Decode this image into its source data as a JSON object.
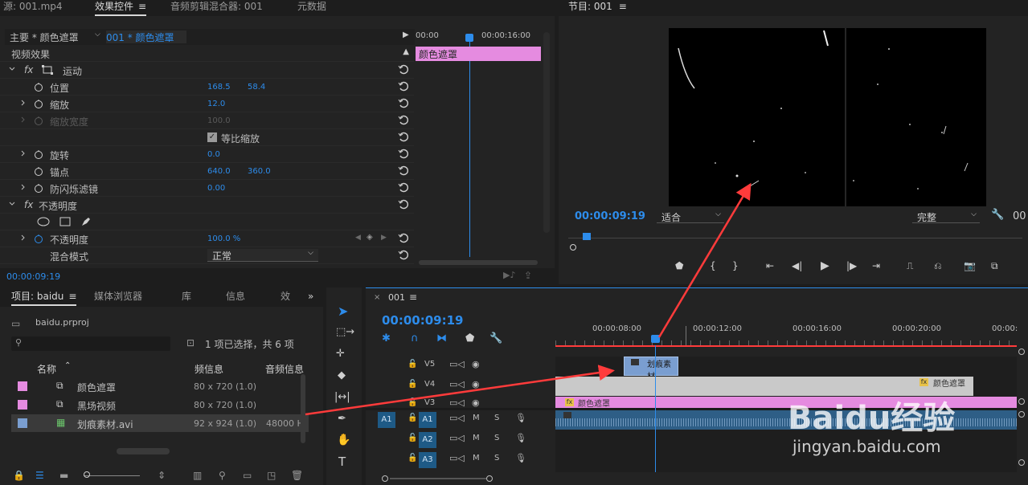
{
  "effect_panel": {
    "tabs": [
      "源: 001.mp4",
      "效果控件",
      "音频剪辑混合器: 001",
      "元数据"
    ],
    "breadcrumb_master": "主要 * 颜色遮罩",
    "breadcrumb_clip": "001 * 颜色遮罩",
    "section": "视频效果",
    "mini_ruler": [
      "00:00",
      "00:00:16:00"
    ],
    "mini_clip": "颜色遮罩",
    "motion": "运动",
    "rows": {
      "position": {
        "label": "位置",
        "v1": "168.5",
        "v2": "58.4"
      },
      "scale": {
        "label": "缩放",
        "v1": "12.0"
      },
      "scale_width": {
        "label": "缩放宽度",
        "v1": "100.0"
      },
      "uniform": {
        "label": "等比缩放"
      },
      "rotation": {
        "label": "旋转",
        "v1": "0.0"
      },
      "anchor": {
        "label": "锚点",
        "v1": "640.0",
        "v2": "360.0"
      },
      "antiflicker": {
        "label": "防闪烁滤镜",
        "v1": "0.00"
      },
      "opacity_group": {
        "label": "不透明度"
      },
      "opacity": {
        "label": "不透明度",
        "v1": "100.0 %"
      },
      "blend": {
        "label": "混合模式",
        "v1": "正常"
      }
    },
    "timecode": "00:00:09:19"
  },
  "program_monitor": {
    "title": "节目: 001",
    "timecode": "00:00:09:19",
    "fit": "适合",
    "quality": "完整",
    "right_timecode_partial": "00"
  },
  "project_panel": {
    "tabs": [
      "项目: baidu",
      "媒体浏览器",
      "库",
      "信息",
      "效"
    ],
    "file": "baidu.prproj",
    "selection": "1 项已选择，共 6 项",
    "headers": {
      "name": "名称",
      "video": "频信息",
      "audio": "音频信息"
    },
    "items": [
      {
        "name": "颜色遮罩",
        "video": "80 x 720 (1.0)",
        "audio": "",
        "color": "#e58be0"
      },
      {
        "name": "黑场视频",
        "video": "80 x 720 (1.0)",
        "audio": "",
        "color": "#e58be0"
      },
      {
        "name": "划痕素材.avi",
        "video": "92 x 924 (1.0)",
        "audio": "48000 H",
        "color": "#7a9ed0"
      }
    ]
  },
  "timeline": {
    "tab": "001",
    "timecode": "00:00:09:19",
    "ruler": [
      "00:00:08:00",
      "00:00:12:00",
      "00:00:16:00",
      "00:00:20:00",
      "00:00:"
    ],
    "tracks": [
      {
        "name": "V5",
        "target": ""
      },
      {
        "name": "V4",
        "target": ""
      },
      {
        "name": "V3",
        "target": ""
      },
      {
        "name": "A1",
        "target": "A1"
      },
      {
        "name": "A2",
        "target": ""
      },
      {
        "name": "A3",
        "target": ""
      }
    ],
    "clips": {
      "v5": "划痕素材",
      "v4": "颜色遮罩",
      "v3": "颜色遮罩"
    },
    "m_label": "M",
    "s_label": "S"
  },
  "watermark": {
    "brand": "Baidu经验",
    "url": "jingyan.baidu.com"
  },
  "colors": {
    "accent": "#2d8ceb",
    "pink": "#e58be0",
    "red": "#ff3b3b",
    "trackblue": "#1e5a86"
  }
}
